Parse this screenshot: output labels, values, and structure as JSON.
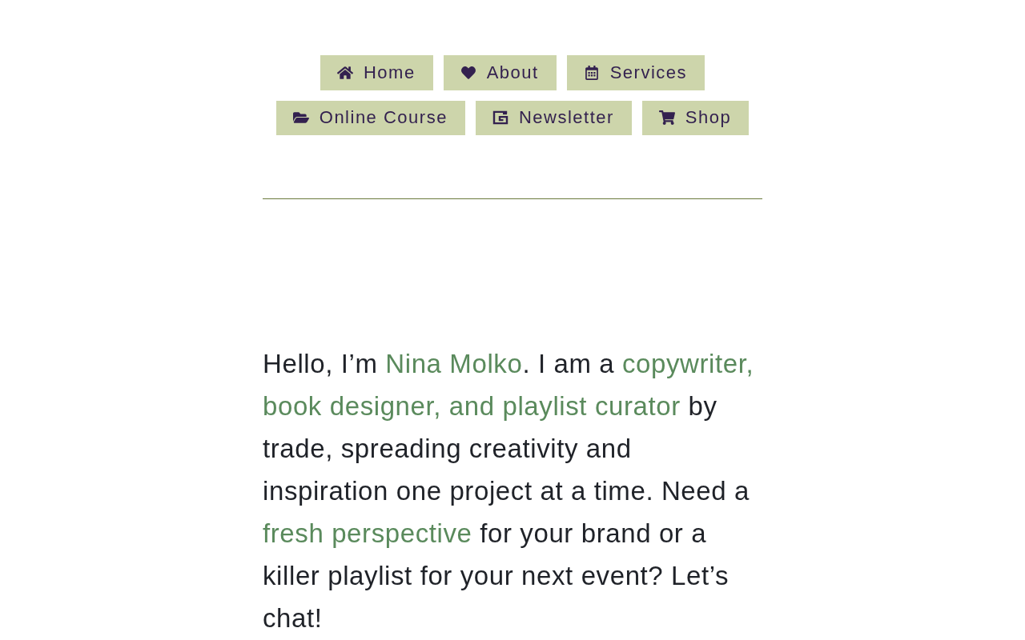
{
  "nav": {
    "items": [
      {
        "label": "Home"
      },
      {
        "label": "About"
      },
      {
        "label": "Services"
      },
      {
        "label": "Online Course"
      },
      {
        "label": "Newsletter"
      },
      {
        "label": "Shop"
      }
    ]
  },
  "intro": {
    "segments": [
      {
        "text": "Hello, I’m ",
        "highlighted": false
      },
      {
        "text": "Nina Molko",
        "highlighted": true
      },
      {
        "text": ". I am a ",
        "highlighted": false
      },
      {
        "text": "copywriter, book designer, and playlist curator",
        "highlighted": true
      },
      {
        "text": " by trade, spreading creativity and inspiration one project at a time. Need a ",
        "highlighted": false
      },
      {
        "text": "fresh perspective",
        "highlighted": true
      },
      {
        "text": " for your brand or a killer playlist for your next event? Let’s chat!",
        "highlighted": false
      }
    ]
  }
}
